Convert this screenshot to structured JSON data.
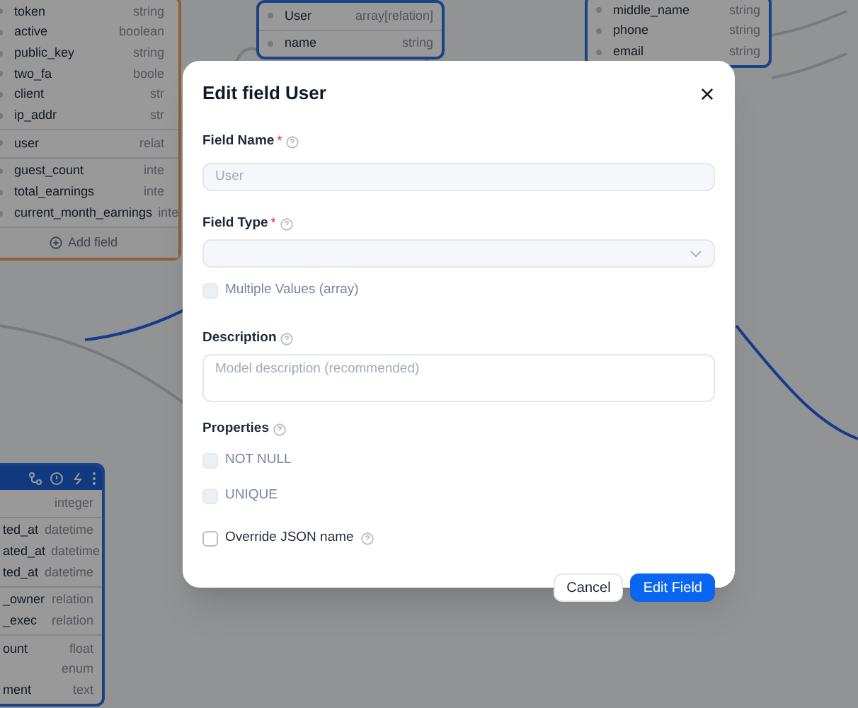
{
  "canvas": {
    "tables": [
      {
        "selected": true,
        "header_icons": false,
        "groups": [
          [
            {
              "name": "token",
              "type": "string"
            },
            {
              "name": "active",
              "type": "boolean"
            },
            {
              "name": "public_key",
              "type": "string"
            },
            {
              "name": "two_fa",
              "type": "boole"
            },
            {
              "name": "client",
              "type": "str"
            },
            {
              "name": "ip_addr",
              "type": "str"
            }
          ],
          [
            {
              "name": "user",
              "type": "relat"
            }
          ],
          [
            {
              "name": "guest_count",
              "type": "inte"
            },
            {
              "name": "total_earnings",
              "type": "inte"
            },
            {
              "name": "current_month_earnings",
              "type": "inte"
            }
          ]
        ],
        "add_field": "Add field"
      },
      {
        "selected": false,
        "header_icons": false,
        "groups": [
          [
            {
              "name": "User",
              "type": "array[relation]"
            }
          ],
          [
            {
              "name": "name",
              "type": "string"
            }
          ]
        ]
      },
      {
        "selected": false,
        "header_icons": false,
        "groups": [
          [
            {
              "name": "middle_name",
              "type": "string"
            },
            {
              "name": "phone",
              "type": "string"
            },
            {
              "name": "email",
              "type": "string"
            }
          ]
        ]
      },
      {
        "selected": false,
        "header_icons": true,
        "groups": [
          [
            {
              "type": "integer"
            }
          ],
          [
            {
              "name": "ted_at",
              "type": "datetime"
            },
            {
              "name": "ated_at",
              "type": "datetime"
            },
            {
              "name": "ted_at",
              "type": "datetime"
            }
          ],
          [
            {
              "name": "_owner",
              "type": "relation"
            },
            {
              "name": "_exec",
              "type": "relation"
            }
          ],
          [
            {
              "name": "ount",
              "type": "float"
            },
            {
              "type": "enum"
            },
            {
              "name": "ment",
              "type": "text"
            }
          ]
        ]
      }
    ]
  },
  "dialog": {
    "title": "Edit field User",
    "fields": [
      {
        "kind": "text",
        "label": "Field Name",
        "required_mark": "*",
        "help": true,
        "placeholder": "User"
      },
      {
        "kind": "select",
        "label": "Field Type",
        "required_mark": "*",
        "help": true
      },
      {
        "kind": "checkbox",
        "label": "Multiple Values (array)",
        "checked": false,
        "disabled": true,
        "help": false
      },
      {
        "kind": "textarea",
        "label": "Description",
        "help": true,
        "placeholder": "Model description (recommended)"
      },
      {
        "kind": "group",
        "label": "Properties",
        "help": true,
        "options": [
          {
            "label": "NOT NULL",
            "checked": false,
            "disabled": true
          },
          {
            "label": "UNIQUE",
            "checked": false,
            "disabled": true
          }
        ]
      },
      {
        "kind": "checkbox",
        "label": "Override JSON name",
        "checked": false,
        "disabled": false,
        "help": true
      }
    ],
    "buttons": [
      {
        "label": "Cancel",
        "kind": "secondary"
      },
      {
        "label": "Edit Field",
        "kind": "primary"
      }
    ]
  }
}
